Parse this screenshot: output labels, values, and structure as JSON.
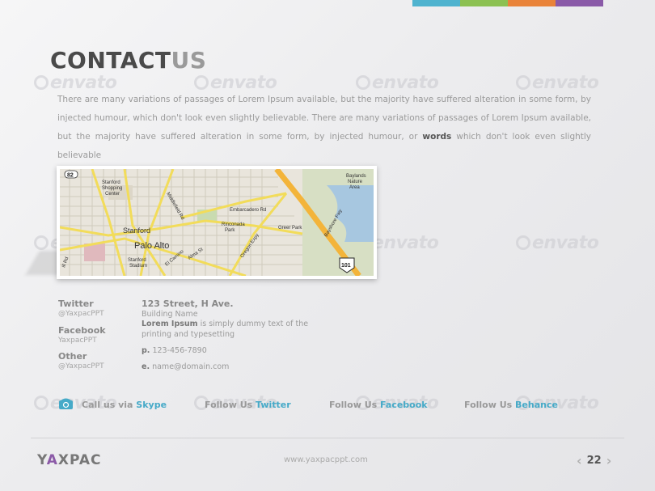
{
  "header": {
    "color_strip": [
      "#4fb3cf",
      "#8cc152",
      "#e9833a",
      "#8a5aa8"
    ],
    "title_part1": "CONTACT",
    "title_part2": "US"
  },
  "watermark_text": "envato",
  "intro": {
    "text_before": "There are many variations of passages of Lorem Ipsum available, but the majority have suffered alteration in some form, by injected humour, which don't look even slightly believable. There are many variations of passages of Lorem Ipsum available, but the majority have suffered alteration in some form, by injected humour, or ",
    "bold_word": "words",
    "text_after": " which don't look even slightly believable"
  },
  "map": {
    "labels": {
      "stanford": "Stanford",
      "palo_alto": "Palo Alto",
      "stanford_shopping": "Stanford",
      "shopping": "Shopping",
      "center": "Center",
      "stanford_stadium": "Stanford",
      "stadium": "Stadium",
      "middlefield": "Middlefield Rd",
      "embarcadero": "Embarcadero Rd",
      "rinconada": "Rinconada",
      "park": "Park",
      "greer": "Greer Park",
      "baylands": "Baylands",
      "nature": "Nature",
      "area": "Area",
      "bayshore": "Bayshore Fwy",
      "oregon": "Oregon Expy",
      "alma": "Alma St",
      "el_camino": "El Camino",
      "hill": "ill Rd",
      "sr82": "82",
      "us101": "101"
    }
  },
  "social": {
    "twitter_label": "Twitter",
    "twitter_handle": "@YaxpacPPT",
    "facebook_label": "Facebook",
    "facebook_handle": "YaxpacPPT",
    "other_label": "Other",
    "other_handle": "@YaxpacPPT"
  },
  "address": {
    "title": "123 Street, H Ave.",
    "building": "Building Name",
    "lorem_bold": "Lorem Ipsum",
    "lorem_rest": " is simply dummy text of the printing and typesetting",
    "phone_label": "p.",
    "phone": "123-456-7890",
    "email_label": "e.",
    "email": "name@domain.com"
  },
  "follow": {
    "skype_prefix": "Call us via ",
    "skype": "Skype",
    "twitter_prefix": "Follow Us ",
    "twitter": "Twitter",
    "facebook_prefix": "Follow Us ",
    "facebook": "Facebook",
    "behance_prefix": "Follow Us ",
    "behance": "Behance"
  },
  "footer": {
    "logo_1": "Y",
    "logo_2": "A",
    "logo_3": "XPAC",
    "url": "www.yaxpacppt.com",
    "page_number": "22"
  }
}
